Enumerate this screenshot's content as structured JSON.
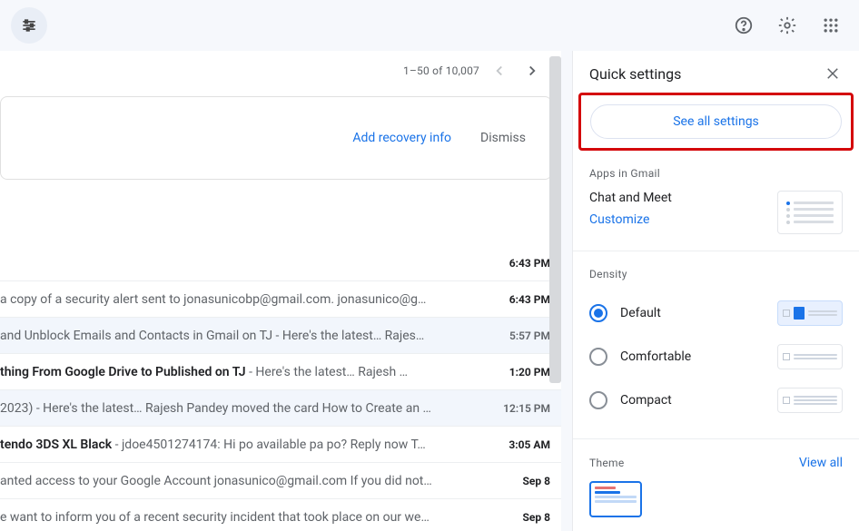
{
  "pagination": {
    "text": "1–50 of 10,007"
  },
  "banner": {
    "link": "Add recovery info",
    "dismiss": "Dismiss"
  },
  "emails": [
    {
      "subject": "",
      "preview": "",
      "time": "6:43 PM",
      "unread": true
    },
    {
      "subject": "",
      "preview": "a copy of a security alert sent to jonasunicobp@gmail.com. jonasunico@g…",
      "time": "6:43 PM",
      "unread": true
    },
    {
      "subject": " and Unblock Emails and Contacts in Gmail on TJ",
      "preview": " - Here's the latest… Rajes…",
      "time": "5:57 PM",
      "unread": false
    },
    {
      "subject": "thing From Google Drive to Published on TJ",
      "preview": " - Here's the latest… Rajesh …",
      "time": "1:20 PM",
      "unread": true
    },
    {
      "subject": "2023)",
      "preview": " - Here's the latest… Rajesh Pandey moved the card How to Create an …",
      "time": "12:15 PM",
      "unread": false
    },
    {
      "subject": "tendo 3DS XL Black",
      "preview": " - jdoe4501274174: Hi po available pa po? Reply now T…",
      "time": "3:05 AM",
      "unread": true
    },
    {
      "subject": "",
      "preview": "anted access to your Google Account jonasunico@gmail.com If you did not…",
      "time": "Sep 8",
      "unread": true
    },
    {
      "subject": "",
      "preview": "e want to inform you of a recent security incident that took place on our we…",
      "time": "Sep 8",
      "unread": true
    }
  ],
  "quicksettings": {
    "title": "Quick settings",
    "see_all": "See all settings",
    "apps_title": "Apps in Gmail",
    "chat_meet": "Chat and Meet",
    "customize": "Customize",
    "density_title": "Density",
    "density": {
      "default": "Default",
      "comfortable": "Comfortable",
      "compact": "Compact"
    },
    "theme_title": "Theme",
    "view_all": "View all"
  }
}
